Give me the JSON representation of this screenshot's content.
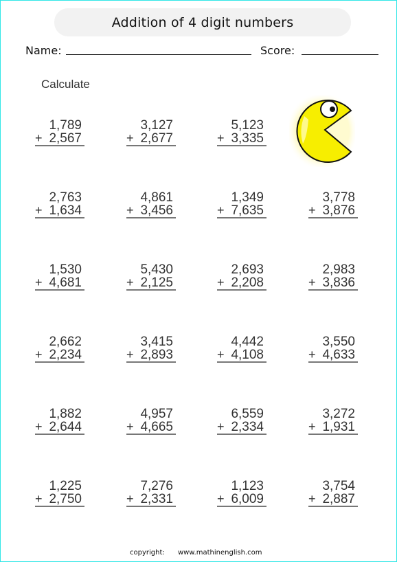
{
  "header": {
    "title": "Addition of 4 digit numbers",
    "name_label": "Name:",
    "score_label": "Score:"
  },
  "instructions": "Calculate",
  "operator": "+",
  "illustration": "pacman-icon",
  "problems": [
    [
      {
        "a": "1,789",
        "b": "2,567"
      },
      {
        "a": "3,127",
        "b": "2,677"
      },
      {
        "a": "5,123",
        "b": "3,335"
      }
    ],
    [
      {
        "a": "2,763",
        "b": "1,634"
      },
      {
        "a": "4,861",
        "b": "3,456"
      },
      {
        "a": "1,349",
        "b": "7,635"
      },
      {
        "a": "3,778",
        "b": "3,876"
      }
    ],
    [
      {
        "a": "1,530",
        "b": "4,681"
      },
      {
        "a": "5,430",
        "b": "2,125"
      },
      {
        "a": "2,693",
        "b": "2,208"
      },
      {
        "a": "2,983",
        "b": "3,836"
      }
    ],
    [
      {
        "a": "2,662",
        "b": "2,234"
      },
      {
        "a": "3,415",
        "b": "2,893"
      },
      {
        "a": "4,442",
        "b": "4,108"
      },
      {
        "a": "3,550",
        "b": "4,633"
      }
    ],
    [
      {
        "a": "1,882",
        "b": "2,644"
      },
      {
        "a": "4,957",
        "b": "4,665"
      },
      {
        "a": "6,559",
        "b": "2,334"
      },
      {
        "a": "3,272",
        "b": "1,931"
      }
    ],
    [
      {
        "a": "1,225",
        "b": "2,750"
      },
      {
        "a": "7,276",
        "b": "2,331"
      },
      {
        "a": "1,123",
        "b": "6,009"
      },
      {
        "a": "3,754",
        "b": "2,887"
      }
    ]
  ],
  "footer": {
    "copyright_label": "copyright:",
    "url": "www.mathinenglish.com"
  },
  "colors": {
    "pacman_fill": "#f7ee00",
    "title_bg": "#f2f2f2",
    "border": "#2ee6e6"
  }
}
